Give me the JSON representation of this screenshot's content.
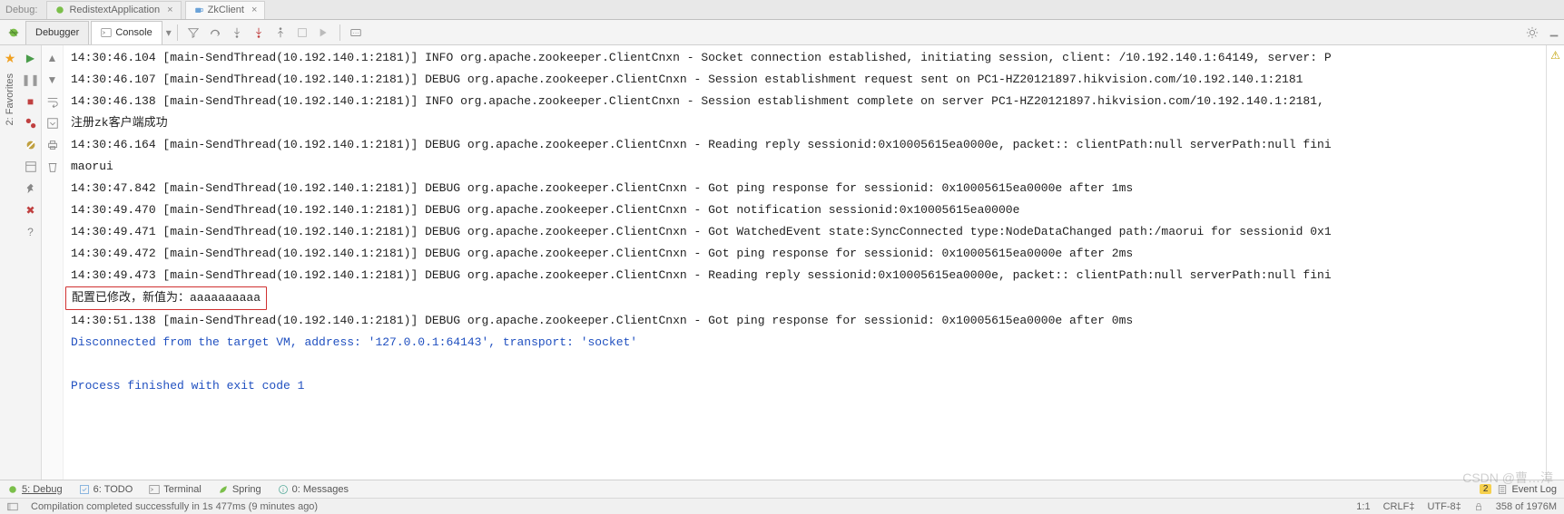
{
  "top": {
    "debug_label": "Debug:",
    "file_tab1": "RedistextApplication",
    "file_tab2": "ZkClient"
  },
  "toolbar": {
    "debugger_tab": "Debugger",
    "console_tab": "Console"
  },
  "log": [
    {
      "cls": "",
      "text": "14:30:46.104 [main-SendThread(10.192.140.1:2181)] INFO org.apache.zookeeper.ClientCnxn - Socket connection established, initiating session, client: /10.192.140.1:64149, server: P"
    },
    {
      "cls": "",
      "text": "14:30:46.107 [main-SendThread(10.192.140.1:2181)] DEBUG org.apache.zookeeper.ClientCnxn - Session establishment request sent on PC1-HZ20121897.hikvision.com/10.192.140.1:2181"
    },
    {
      "cls": "",
      "text": "14:30:46.138 [main-SendThread(10.192.140.1:2181)] INFO org.apache.zookeeper.ClientCnxn - Session establishment complete on server PC1-HZ20121897.hikvision.com/10.192.140.1:2181,"
    },
    {
      "cls": "",
      "text": "注册zk客户端成功"
    },
    {
      "cls": "",
      "text": "14:30:46.164 [main-SendThread(10.192.140.1:2181)] DEBUG org.apache.zookeeper.ClientCnxn - Reading reply sessionid:0x10005615ea0000e, packet:: clientPath:null serverPath:null fini"
    },
    {
      "cls": "",
      "text": "maorui"
    },
    {
      "cls": "",
      "text": "14:30:47.842 [main-SendThread(10.192.140.1:2181)] DEBUG org.apache.zookeeper.ClientCnxn - Got ping response for sessionid: 0x10005615ea0000e after 1ms"
    },
    {
      "cls": "",
      "text": "14:30:49.470 [main-SendThread(10.192.140.1:2181)] DEBUG org.apache.zookeeper.ClientCnxn - Got notification sessionid:0x10005615ea0000e"
    },
    {
      "cls": "",
      "text": "14:30:49.471 [main-SendThread(10.192.140.1:2181)] DEBUG org.apache.zookeeper.ClientCnxn - Got WatchedEvent state:SyncConnected type:NodeDataChanged path:/maorui for sessionid 0x1"
    },
    {
      "cls": "",
      "text": "14:30:49.472 [main-SendThread(10.192.140.1:2181)] DEBUG org.apache.zookeeper.ClientCnxn - Got ping response for sessionid: 0x10005615ea0000e after 2ms"
    },
    {
      "cls": "",
      "text": "14:30:49.473 [main-SendThread(10.192.140.1:2181)] DEBUG org.apache.zookeeper.ClientCnxn - Reading reply sessionid:0x10005615ea0000e, packet:: clientPath:null serverPath:null fini"
    },
    {
      "cls": "framed",
      "text": "配置已修改，新值为：aaaaaaaaaa"
    },
    {
      "cls": "",
      "text": "14:30:51.138 [main-SendThread(10.192.140.1:2181)] DEBUG org.apache.zookeeper.ClientCnxn - Got ping response for sessionid: 0x10005615ea0000e after 0ms"
    },
    {
      "cls": "blue",
      "text": "Disconnected from the target VM, address: '127.0.0.1:64143', transport: 'socket'"
    },
    {
      "cls": "",
      "text": ""
    },
    {
      "cls": "blue",
      "text": "Process finished with exit code 1"
    }
  ],
  "sidetab": {
    "favorites": "2: Favorites"
  },
  "bottombar": {
    "debug": "5: Debug",
    "todo": "6: TODO",
    "terminal": "Terminal",
    "spring": "Spring",
    "messages": "0: Messages",
    "eventlog": "Event Log",
    "badge": "2"
  },
  "status": {
    "msg": "Compilation completed successfully in 1s 477ms (9 minutes ago)",
    "pos": "1:1",
    "crlf": "CRLF‡",
    "enc": "UTF-8‡",
    "mem": "358 of 1976M"
  },
  "watermark": "CSDN @曹…漳"
}
